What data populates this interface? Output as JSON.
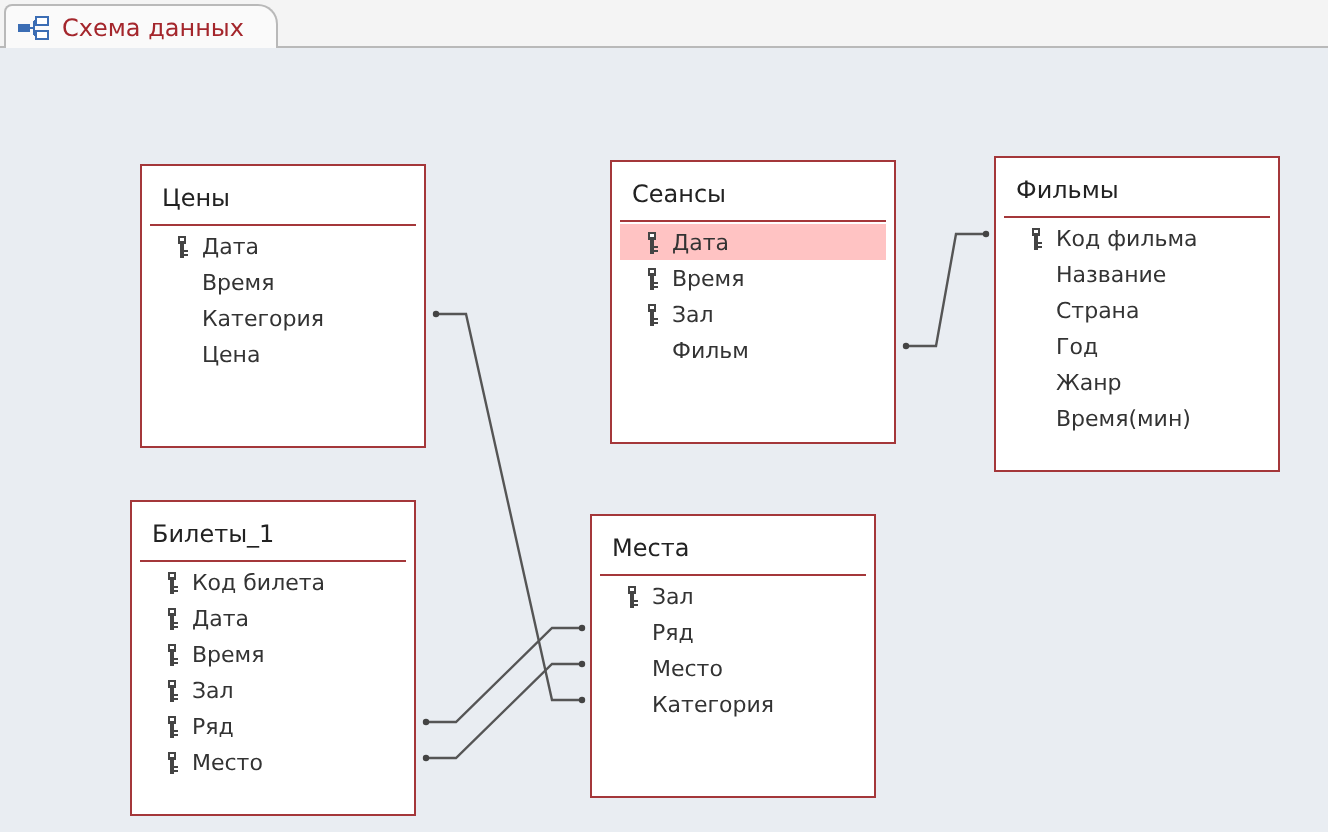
{
  "tab": {
    "label": "Схема данных",
    "selected": true
  },
  "tables": [
    {
      "name": "Цены",
      "fields": [
        {
          "name": "Дата",
          "key": true,
          "selected": false
        },
        {
          "name": "Время",
          "key": false,
          "selected": false
        },
        {
          "name": "Категория",
          "key": false,
          "selected": false
        },
        {
          "name": "Цена",
          "key": false,
          "selected": false
        }
      ]
    },
    {
      "name": "Сеансы",
      "fields": [
        {
          "name": "Дата",
          "key": true,
          "selected": true
        },
        {
          "name": "Время",
          "key": true,
          "selected": false
        },
        {
          "name": "Зал",
          "key": true,
          "selected": false
        },
        {
          "name": "Фильм",
          "key": false,
          "selected": false
        }
      ]
    },
    {
      "name": "Фильмы",
      "fields": [
        {
          "name": "Код фильма",
          "key": true,
          "selected": false
        },
        {
          "name": "Название",
          "key": false,
          "selected": false
        },
        {
          "name": "Страна",
          "key": false,
          "selected": false
        },
        {
          "name": "Год",
          "key": false,
          "selected": false
        },
        {
          "name": "Жанр",
          "key": false,
          "selected": false
        },
        {
          "name": "Время(мин)",
          "key": false,
          "selected": false
        }
      ]
    },
    {
      "name": "Билеты_1",
      "fields": [
        {
          "name": "Код билета",
          "key": true,
          "selected": false
        },
        {
          "name": "Дата",
          "key": true,
          "selected": false
        },
        {
          "name": "Время",
          "key": true,
          "selected": false
        },
        {
          "name": "Зал",
          "key": true,
          "selected": false
        },
        {
          "name": "Ряд",
          "key": true,
          "selected": false
        },
        {
          "name": "Место",
          "key": true,
          "selected": false
        }
      ]
    },
    {
      "name": "Места",
      "fields": [
        {
          "name": "Зал",
          "key": true,
          "selected": false
        },
        {
          "name": "Ряд",
          "key": false,
          "selected": false
        },
        {
          "name": "Место",
          "key": false,
          "selected": false
        },
        {
          "name": "Категория",
          "key": false,
          "selected": false
        }
      ]
    }
  ]
}
